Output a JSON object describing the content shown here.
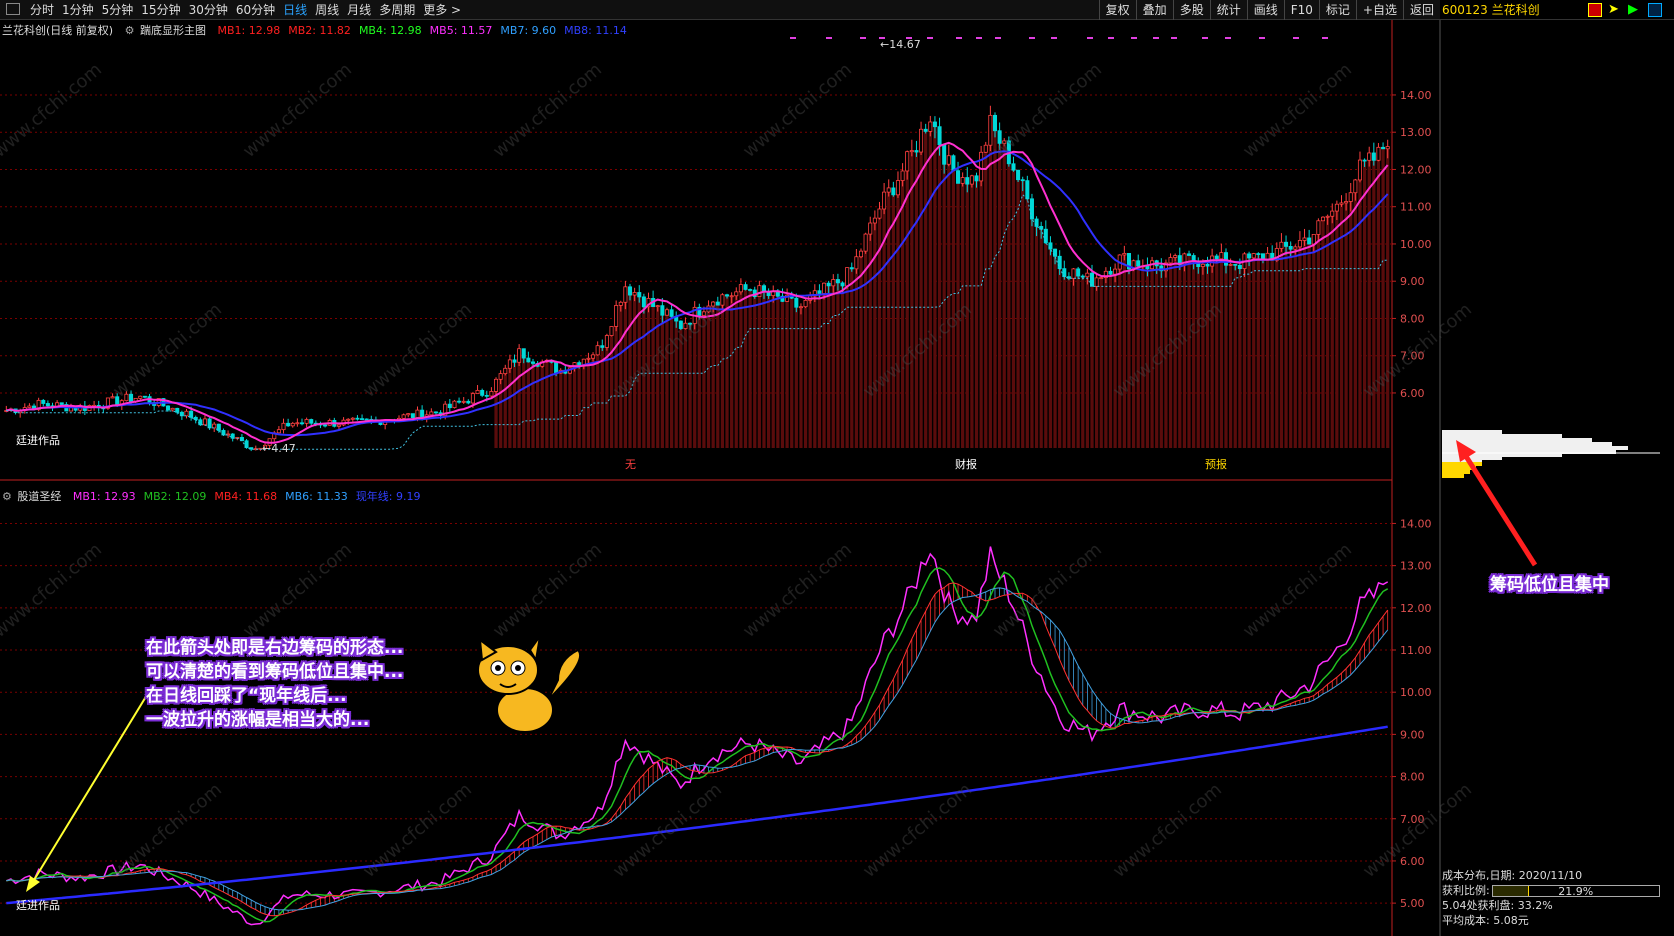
{
  "toolbar": {
    "items": [
      "分时",
      "1分钟",
      "5分钟",
      "15分钟",
      "30分钟",
      "60分钟",
      "日线",
      "周线",
      "月线",
      "多周期",
      "更多 >"
    ],
    "active": "日线",
    "right_items": [
      "复权",
      "叠加",
      "多股",
      "统计",
      "画线",
      "F10",
      "标记",
      "+自选",
      "返回"
    ]
  },
  "stock": {
    "code_name": "600123 兰花科创"
  },
  "main_chart": {
    "title": "兰花科创(日线 前复权)",
    "indicator_name": "踹底显形主图",
    "mb": [
      {
        "label": "MB1: 12.98",
        "color": "#ff2020"
      },
      {
        "label": "MB2: 11.82",
        "color": "#ff2020"
      },
      {
        "label": "MB4: 12.98",
        "color": "#20ff20"
      },
      {
        "label": "MB5: 11.57",
        "color": "#ff30ff"
      },
      {
        "label": "MB7: 9.60",
        "color": "#30a0ff"
      },
      {
        "label": "MB8: 11.14",
        "color": "#3040ff"
      }
    ],
    "y_ticks": [
      "14.00",
      "13.00",
      "12.00",
      "11.00",
      "10.00",
      "9.00",
      "8.00",
      "7.00",
      "6.00"
    ],
    "high_label": "14.67",
    "low_label": "4.47",
    "markers": [
      "无",
      "财报",
      "预报"
    ],
    "signature": "廷进作品"
  },
  "sub_chart": {
    "indicator_name": "股道圣经",
    "mb": [
      {
        "label": "MB1: 12.93",
        "color": "#ff30ff"
      },
      {
        "label": "MB2: 12.09",
        "color": "#20c020"
      },
      {
        "label": "MB4: 11.68",
        "color": "#ff2020"
      },
      {
        "label": "MB6: 11.33",
        "color": "#30a0ff"
      },
      {
        "label": "现年线: 9.19",
        "color": "#3040ff"
      }
    ],
    "y_ticks": [
      "14.00",
      "13.00",
      "12.00",
      "11.00",
      "10.00",
      "9.00",
      "8.00",
      "7.00",
      "6.00",
      "5.00"
    ],
    "signature": "廷进作品"
  },
  "annotations": {
    "left_lines": [
      "在此箭头处即是右边筹码的形态...",
      "可以清楚的看到筹码低位且集中...",
      "在日线回踩了“现年线后...",
      "一波拉升的涨幅是相当大的..."
    ],
    "right_label": "筹码低位且集中"
  },
  "chip_panel": {
    "date_label": "成本分布,日期:",
    "date": "2020/11/10",
    "profit_ratio_label": "获利比例:",
    "profit_ratio": "21.9%",
    "profit_ratio_value": 0.219,
    "profit_at_label": "5.04处获利盘:",
    "profit_at": "33.2%",
    "avg_cost_label": "平均成本:",
    "avg_cost": "5.08元"
  },
  "watermark": "www.cfchi.com",
  "colors": {
    "up": "#ff3030",
    "down": "#00e0e0",
    "grid": "#7a0000",
    "axis": "#c02020"
  }
}
